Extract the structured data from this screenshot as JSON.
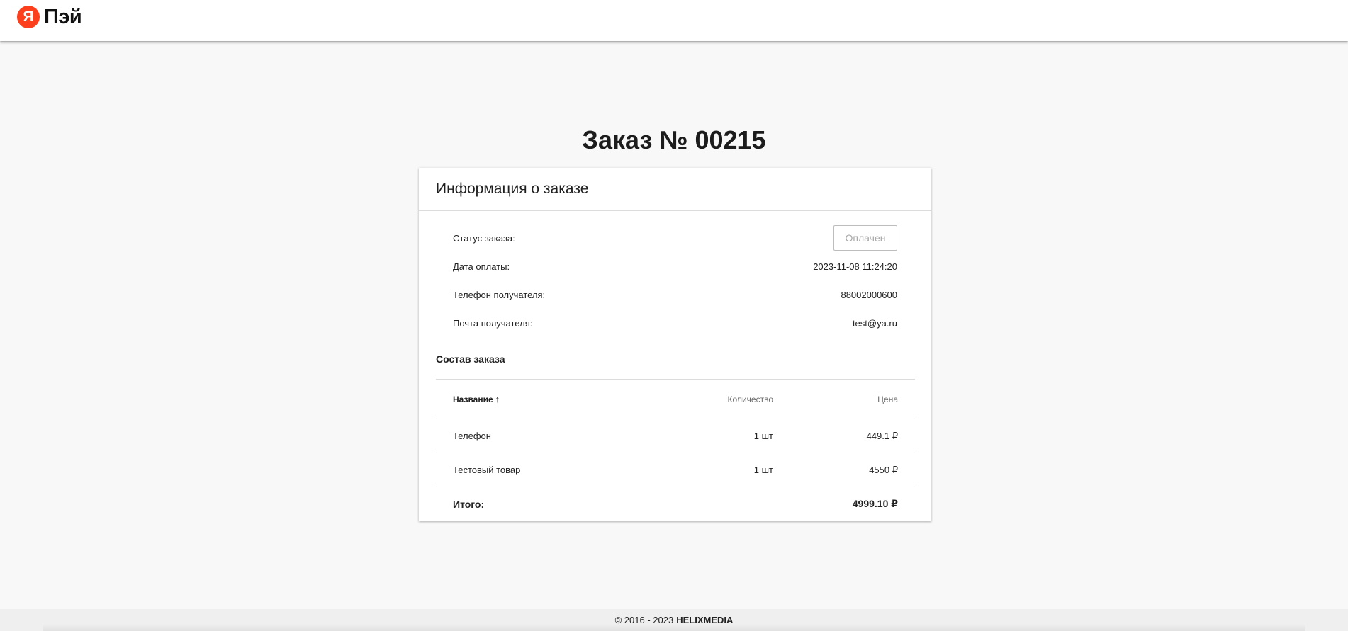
{
  "header": {
    "logo_letter": "Я",
    "logo_text": "Пэй"
  },
  "page": {
    "title": "Заказ № 00215"
  },
  "card": {
    "title": "Информация о заказе",
    "rows": [
      {
        "label": "Статус заказа:",
        "value": "Оплачен"
      },
      {
        "label": "Дата оплаты:",
        "value": "2023-11-08 11:24:20"
      },
      {
        "label": "Телефон получателя:",
        "value": "88002000600"
      },
      {
        "label": "Почта получателя:",
        "value": "test@ya.ru"
      }
    ],
    "composition_title": "Состав заказа",
    "table": {
      "columns": {
        "name": "Название",
        "qty": "Количество",
        "price": "Цена"
      },
      "sort_icon": "↑",
      "items": [
        {
          "name": "Телефон",
          "qty": "1 шт",
          "price": "449.1 ₽"
        },
        {
          "name": "Тестовый товар",
          "qty": "1 шт",
          "price": "4550 ₽"
        }
      ],
      "total_label": "Итого:",
      "total_value": "4999.10 ₽"
    }
  },
  "footer": {
    "copyright": "© 2016 - 2023",
    "company": "HELIXMEDIA"
  },
  "colors": {
    "brand_red": "#fc3f1d",
    "background": "#f8f8f8"
  },
  "icons": {
    "sort": "arrow-up-icon"
  }
}
